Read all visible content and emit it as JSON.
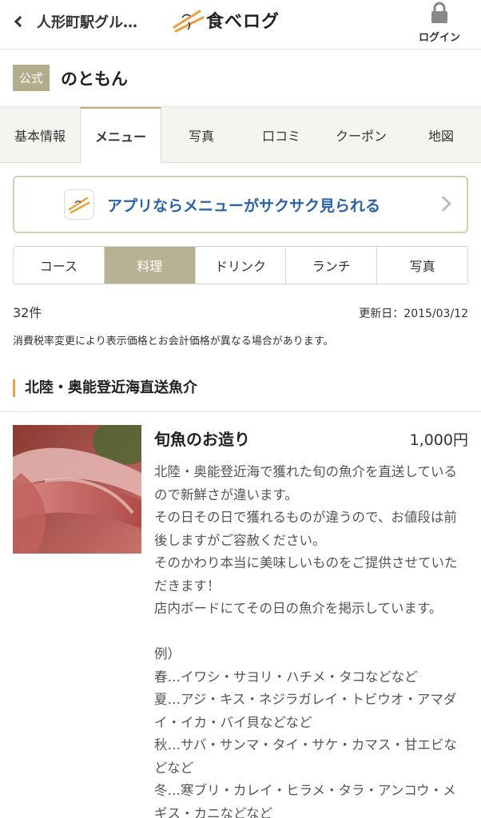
{
  "header": {
    "back_label": "人形町駅グル…",
    "logo_text": "食べログ",
    "login_label": "ログイン"
  },
  "shop": {
    "badge": "公式",
    "name": "のともん"
  },
  "tabs": [
    {
      "label": "基本情報",
      "active": false
    },
    {
      "label": "メニュー",
      "active": true
    },
    {
      "label": "写真",
      "active": false
    },
    {
      "label": "口コミ",
      "active": false
    },
    {
      "label": "クーポン",
      "active": false
    },
    {
      "label": "地図",
      "active": false
    }
  ],
  "app_banner": {
    "text": "アプリならメニューがサクサク見られる"
  },
  "subtabs": [
    {
      "label": "コース",
      "active": false
    },
    {
      "label": "料理",
      "active": true
    },
    {
      "label": "ドリンク",
      "active": false
    },
    {
      "label": "ランチ",
      "active": false
    },
    {
      "label": "写真",
      "active": false
    }
  ],
  "meta": {
    "count": "32件",
    "updated": "更新日：2015/03/12",
    "notice": "消費税率変更により表示価格とお会計価格が異なる場合があります。"
  },
  "section": {
    "title": "北陸・奥能登近海直送魚介"
  },
  "item": {
    "name": "旬魚のお造り",
    "price": "1,000円",
    "description": "北陸・奥能登近海で獲れた旬の魚介を直送しているので新鮮さが違います。\nその日その日で獲れるものが違うので、お値段は前後しますがご容赦ください。\nそのかわり本当に美味しいものをご提供させていただきます！\n店内ボードにてその日の魚介を掲示しています。\n\n例）\n春…イワシ・サヨリ・ハチメ・タコなどなど\n夏…アジ・キス・ネジラガレイ・トビウオ・アマダイ・イカ・バイ貝などなど\n秋…サバ・サンマ・タイ・サケ・カマス・甘エビなどなど\n冬…寒ブリ・カレイ・ヒラメ・タラ・アンコウ・メギス・カニなどなど"
  },
  "colors": {
    "accent_gold": "#b8b295",
    "section_bar": "#e9a43b",
    "link_blue": "#2b62a8"
  }
}
